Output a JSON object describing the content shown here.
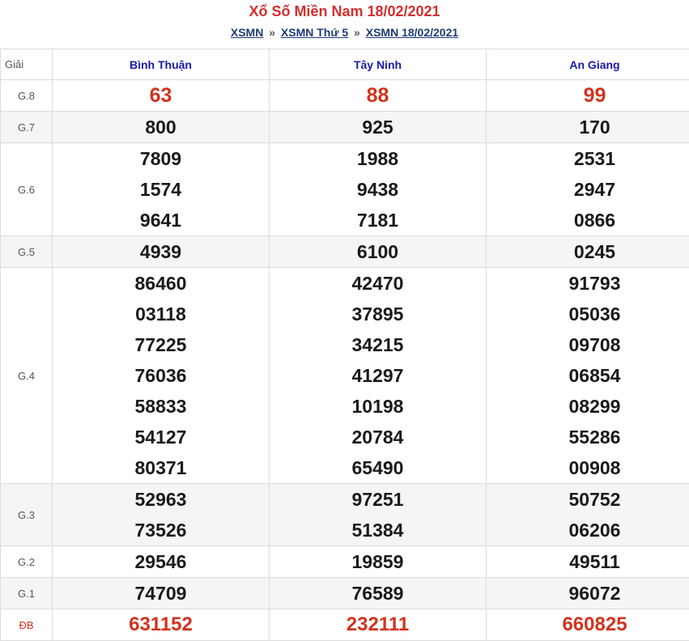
{
  "title": "Xổ Số Miền Nam 18/02/2021",
  "breadcrumb": {
    "items": [
      "XSMN",
      "XSMN Thứ 5",
      "XSMN 18/02/2021"
    ],
    "separator": "»"
  },
  "table": {
    "label_header": "Giải",
    "provinces": [
      "Bình Thuận",
      "Tây Ninh",
      "An Giang"
    ],
    "prizes": [
      {
        "label": "G.8",
        "values": [
          [
            "63"
          ],
          [
            "88"
          ],
          [
            "99"
          ]
        ]
      },
      {
        "label": "G.7",
        "values": [
          [
            "800"
          ],
          [
            "925"
          ],
          [
            "170"
          ]
        ]
      },
      {
        "label": "G.6",
        "values": [
          [
            "7809",
            "1574",
            "9641"
          ],
          [
            "1988",
            "9438",
            "7181"
          ],
          [
            "2531",
            "2947",
            "0866"
          ]
        ]
      },
      {
        "label": "G.5",
        "values": [
          [
            "4939"
          ],
          [
            "6100"
          ],
          [
            "0245"
          ]
        ]
      },
      {
        "label": "G.4",
        "values": [
          [
            "86460",
            "03118",
            "77225",
            "76036",
            "58833",
            "54127",
            "80371"
          ],
          [
            "42470",
            "37895",
            "34215",
            "41297",
            "10198",
            "20784",
            "65490"
          ],
          [
            "91793",
            "05036",
            "09708",
            "06854",
            "08299",
            "55286",
            "00908"
          ]
        ]
      },
      {
        "label": "G.3",
        "values": [
          [
            "52963",
            "73526"
          ],
          [
            "97251",
            "51384"
          ],
          [
            "50752",
            "06206"
          ]
        ]
      },
      {
        "label": "G.2",
        "values": [
          [
            "29546"
          ],
          [
            "19859"
          ],
          [
            "49511"
          ]
        ]
      },
      {
        "label": "G.1",
        "values": [
          [
            "74709"
          ],
          [
            "76589"
          ],
          [
            "96072"
          ]
        ]
      },
      {
        "label": "ĐB",
        "values": [
          [
            "631152"
          ],
          [
            "232111"
          ],
          [
            "660825"
          ]
        ]
      }
    ]
  },
  "colors": {
    "title": "#d32f2f",
    "highlight_number": "#d1331e",
    "province_header": "#1a1aa6",
    "link": "#1f3a7a"
  }
}
